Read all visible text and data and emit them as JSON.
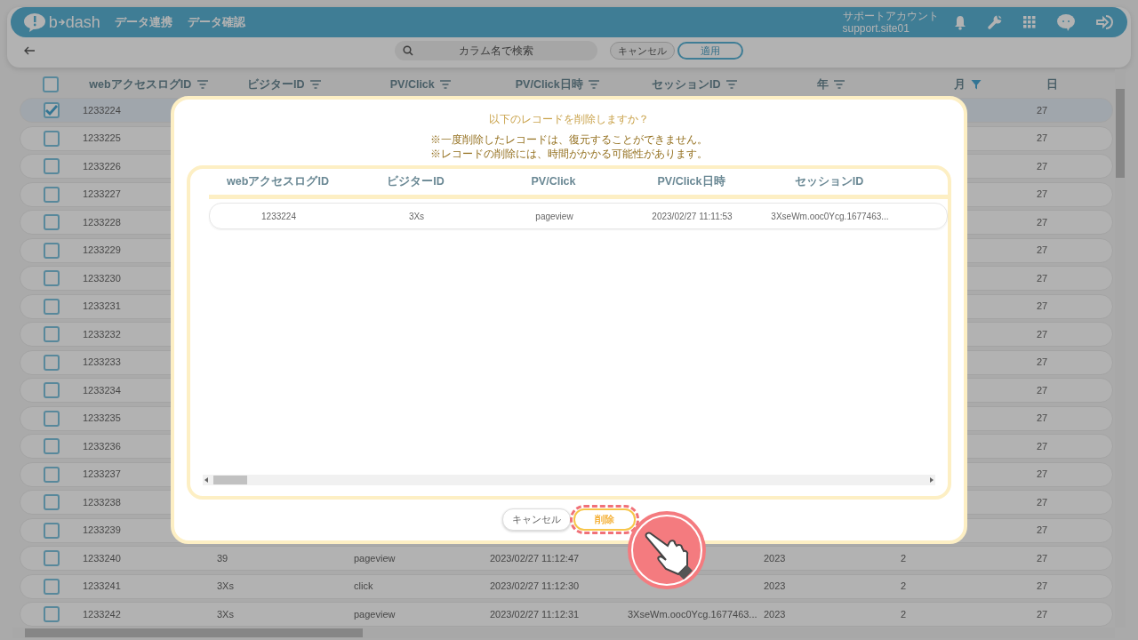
{
  "app": {
    "logo": [
      "b",
      "dash"
    ],
    "nav": [
      "データ連携",
      "データ確認"
    ],
    "account": {
      "name": "サポートアカウント",
      "id": "support.site01"
    }
  },
  "toolbar": {
    "search": {
      "placeholder": "カラム名で検索"
    },
    "cancel": "キャンセル",
    "apply": "適用"
  },
  "table": {
    "all_checked": false,
    "columns": [
      {
        "label": "webアクセスログID",
        "kind": "filter"
      },
      {
        "label": "ビジターID",
        "kind": "filter"
      },
      {
        "label": "PV/Click",
        "kind": "filter"
      },
      {
        "label": "PV/Click日時",
        "kind": "filter"
      },
      {
        "label": "セッションID",
        "kind": "filter"
      },
      {
        "label": "年",
        "kind": "filter"
      },
      {
        "label": "月",
        "kind": "filtered"
      },
      {
        "label": "日",
        "kind": "plain"
      }
    ],
    "rows": [
      {
        "checked": true,
        "cells": [
          "1233224",
          "",
          "",
          "",
          "",
          "",
          "",
          "27"
        ]
      },
      {
        "checked": false,
        "cells": [
          "1233225",
          "",
          "",
          "",
          "",
          "",
          "",
          "27"
        ]
      },
      {
        "checked": false,
        "cells": [
          "1233226",
          "",
          "",
          "",
          "",
          "",
          "",
          "27"
        ]
      },
      {
        "checked": false,
        "cells": [
          "1233227",
          "",
          "",
          "",
          "",
          "",
          "",
          "27"
        ]
      },
      {
        "checked": false,
        "cells": [
          "1233228",
          "",
          "",
          "",
          "",
          "",
          "",
          "27"
        ]
      },
      {
        "checked": false,
        "cells": [
          "1233229",
          "",
          "",
          "",
          "",
          "",
          "",
          "27"
        ]
      },
      {
        "checked": false,
        "cells": [
          "1233230",
          "",
          "",
          "",
          "",
          "",
          "",
          "27"
        ]
      },
      {
        "checked": false,
        "cells": [
          "1233231",
          "",
          "",
          "",
          "",
          "",
          "",
          "27"
        ]
      },
      {
        "checked": false,
        "cells": [
          "1233232",
          "",
          "",
          "",
          "",
          "",
          "",
          "27"
        ]
      },
      {
        "checked": false,
        "cells": [
          "1233233",
          "",
          "",
          "",
          "",
          "",
          "",
          "27"
        ]
      },
      {
        "checked": false,
        "cells": [
          "1233234",
          "",
          "",
          "",
          "",
          "",
          "",
          "27"
        ]
      },
      {
        "checked": false,
        "cells": [
          "1233235",
          "",
          "",
          "",
          "",
          "",
          "",
          "27"
        ]
      },
      {
        "checked": false,
        "cells": [
          "1233236",
          "",
          "",
          "",
          "",
          "",
          "",
          "27"
        ]
      },
      {
        "checked": false,
        "cells": [
          "1233237",
          "",
          "",
          "",
          "",
          "",
          "",
          "27"
        ]
      },
      {
        "checked": false,
        "cells": [
          "1233238",
          "",
          "",
          "",
          "",
          "",
          "",
          "27"
        ]
      },
      {
        "checked": false,
        "cells": [
          "1233239",
          "",
          "",
          "",
          "",
          "",
          "",
          "27"
        ]
      },
      {
        "checked": false,
        "cells": [
          "1233240",
          "39",
          "pageview",
          "2023/02/27 11:12:47",
          "",
          "2023",
          "2",
          "27"
        ]
      },
      {
        "checked": false,
        "cells": [
          "1233241",
          "3Xs",
          "click",
          "2023/02/27 11:12:30",
          "",
          "2023",
          "2",
          "27"
        ]
      },
      {
        "checked": false,
        "cells": [
          "1233242",
          "3Xs",
          "pageview",
          "2023/02/27 11:12:31",
          "3XseWm.ooc0Ycg.1677463...",
          "2023",
          "2",
          "27"
        ]
      }
    ]
  },
  "dialog": {
    "title": "以下のレコードを削除しますか？",
    "notes": [
      "※一度削除したレコードは、復元することができません。",
      "※レコードの削除には、時間がかかる可能性があります。"
    ],
    "columns": [
      "webアクセスログID",
      "ビジターID",
      "PV/Click",
      "PV/Click日時",
      "セッションID"
    ],
    "rows": [
      [
        "1233224",
        "3Xs",
        "pageview",
        "2023/02/27 11:11:53",
        "3XseWm.ooc0Ycg.1677463..."
      ]
    ],
    "cancel": "キャンセル",
    "delete": {
      "label": "削除",
      "highlighted": true
    }
  }
}
